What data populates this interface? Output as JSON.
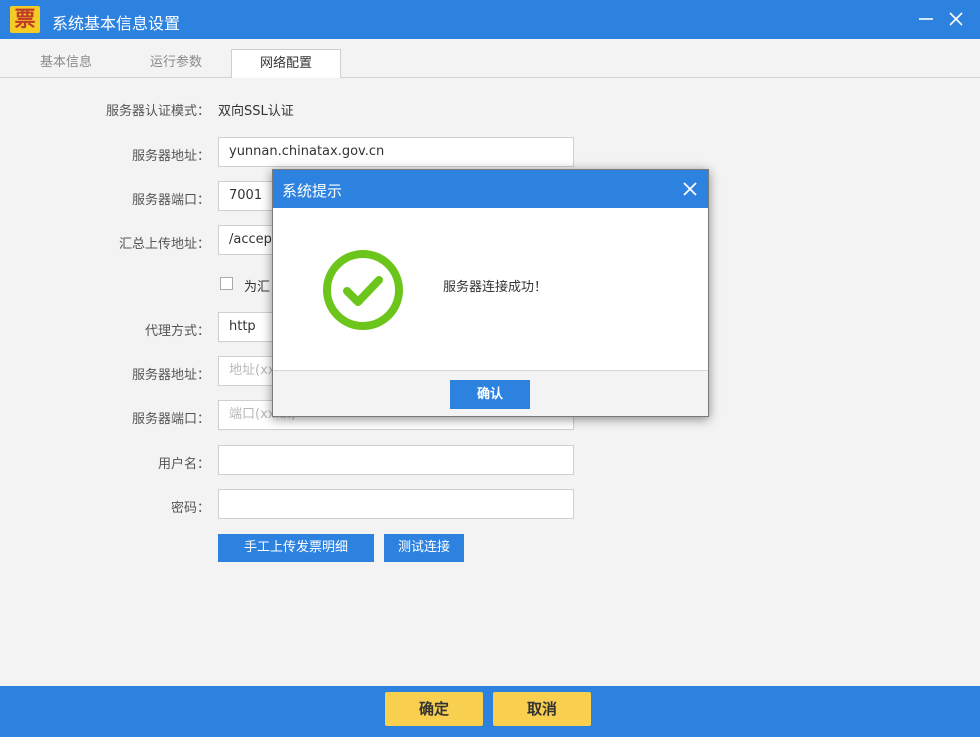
{
  "window": {
    "logo_char": "票",
    "title": "系统基本信息设置"
  },
  "tabs": [
    {
      "label": "基本信息"
    },
    {
      "label": "运行参数"
    },
    {
      "label": "网络配置"
    }
  ],
  "form": {
    "auth_mode": {
      "label": "服务器认证模式：",
      "value": "双向SSL认证"
    },
    "server_address": {
      "label": "服务器地址：",
      "value": "yunnan.chinatax.gov.cn"
    },
    "server_port": {
      "label": "服务器端口：",
      "value": "7001"
    },
    "upload_address": {
      "label": "汇总上传地址：",
      "value": "/accep"
    },
    "checkbox_label": "为汇",
    "proxy_mode": {
      "label": "代理方式：",
      "value": "http"
    },
    "proxy_address": {
      "label": "服务器地址：",
      "placeholder": "地址(xx"
    },
    "proxy_port": {
      "label": "服务器端口：",
      "placeholder": "端口(xxxx)"
    },
    "username": {
      "label": "用户名：",
      "value": ""
    },
    "password": {
      "label": "密码：",
      "value": ""
    },
    "upload_button": "手工上传发票明细",
    "test_button": "测试连接"
  },
  "footer": {
    "ok": "确定",
    "cancel": "取消"
  },
  "dialog": {
    "title": "系统提示",
    "message": "服务器连接成功！",
    "confirm": "确认",
    "icon": "success-check-icon"
  },
  "colors": {
    "primary": "#2d82e0",
    "footer_button": "#f9cf4f",
    "success": "#6cc51a"
  }
}
